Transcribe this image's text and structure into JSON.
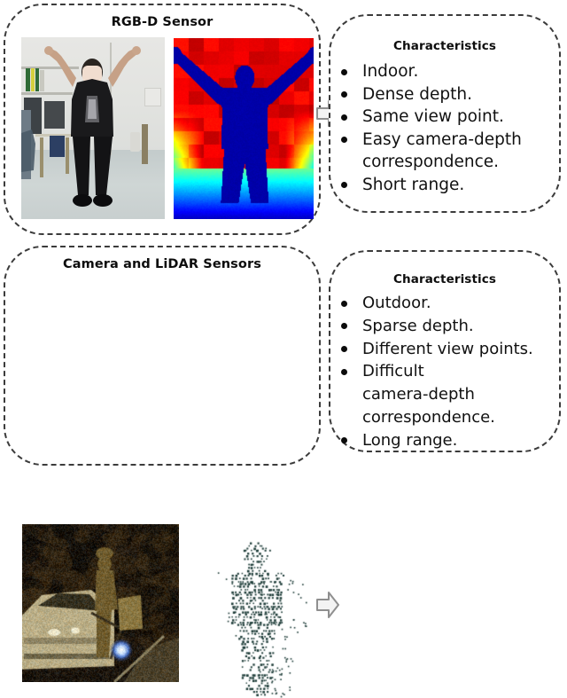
{
  "figure": {
    "panels": [
      {
        "id": "rgbd",
        "title": "RGB-D Sensor",
        "images": [
          {
            "name": "rgb-photo",
            "caption": "RGB photo of person with raised arms indoors"
          },
          {
            "name": "depth-map",
            "caption": "Jet-colormap dense depth map of the same person"
          }
        ]
      },
      {
        "id": "lidar",
        "title": "Camera and LiDAR Sensors",
        "images": [
          {
            "name": "night-photo",
            "caption": "Low-light outdoor photo of a person near a car"
          },
          {
            "name": "point-cloud",
            "caption": "Sparse LiDAR point cloud of a pedestrian"
          }
        ]
      }
    ],
    "characteristics": [
      {
        "id": "rgbd-characteristics",
        "title": "Characteristics",
        "items": [
          {
            "text": "Indoor.",
            "lines": [
              "Indoor."
            ]
          },
          {
            "text": "Dense depth.",
            "lines": [
              "Dense depth."
            ]
          },
          {
            "text": "Same view point.",
            "lines": [
              "Same view point."
            ]
          },
          {
            "text": "Easy camera-depth correspondence.",
            "lines": [
              "Easy camera-depth",
              "correspondence."
            ]
          },
          {
            "text": "Short range.",
            "lines": [
              "Short range."
            ]
          }
        ]
      },
      {
        "id": "lidar-characteristics",
        "title": "Characteristics",
        "items": [
          {
            "text": "Outdoor.",
            "lines": [
              "Outdoor."
            ]
          },
          {
            "text": "Sparse depth.",
            "lines": [
              "Sparse depth."
            ]
          },
          {
            "text": "Different view points.",
            "lines": [
              "Different view points."
            ]
          },
          {
            "text": "Difficult camera-depth correspondence.",
            "lines": [
              "Difficult",
              "camera-depth",
              "correspondence."
            ]
          },
          {
            "text": "Long range.",
            "lines": [
              "Long range."
            ]
          }
        ]
      }
    ],
    "arrows": [
      {
        "name": "arrow-rgbd",
        "direction": "right"
      },
      {
        "name": "arrow-lidar",
        "direction": "right"
      }
    ],
    "colors": {
      "panel_border": "#3b3b3b",
      "text": "#111111",
      "bullet": "#0b0b0b",
      "arrow_fill": "#f2f2f2",
      "arrow_stroke": "#8c8c8c",
      "point_cloud": "#1b3a36"
    }
  }
}
